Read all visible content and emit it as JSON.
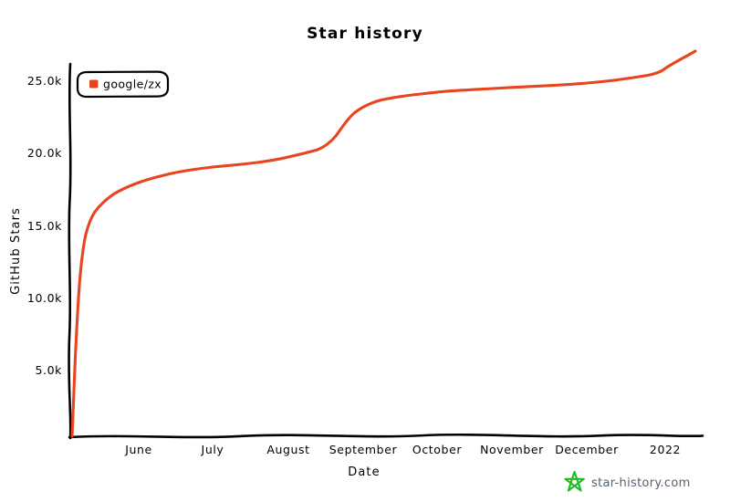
{
  "chart_data": {
    "type": "line",
    "title": "Star history",
    "xlabel": "Date",
    "ylabel": "GitHub Stars",
    "grid": false,
    "legend_position": "top-left",
    "x_tick_labels": [
      "June",
      "July",
      "August",
      "September",
      "October",
      "November",
      "December",
      "2022"
    ],
    "y_tick_labels": [
      "5.0k",
      "10.0k",
      "15.0k",
      "20.0k",
      "25.0k"
    ],
    "y_tick_values": [
      5000,
      10000,
      15000,
      20000,
      25000
    ],
    "ylim": [
      0,
      26500
    ],
    "xlim": [
      "2021-05-12",
      "2022-01-20"
    ],
    "series": [
      {
        "name": "google/zx",
        "color": "#E8441E",
        "x": [
          "2021-05-13",
          "2021-05-14",
          "2021-05-15",
          "2021-05-16",
          "2021-05-17",
          "2021-05-18",
          "2021-05-20",
          "2021-05-23",
          "2021-05-27",
          "2021-06-01",
          "2021-06-08",
          "2021-06-15",
          "2021-06-22",
          "2021-07-01",
          "2021-07-10",
          "2021-07-20",
          "2021-08-01",
          "2021-08-10",
          "2021-08-20",
          "2021-08-28",
          "2021-09-02",
          "2021-09-06",
          "2021-09-10",
          "2021-09-14",
          "2021-09-20",
          "2021-09-28",
          "2021-10-08",
          "2021-10-20",
          "2021-11-01",
          "2021-11-12",
          "2021-11-22",
          "2021-12-01",
          "2021-12-12",
          "2021-12-22",
          "2022-01-01",
          "2022-01-08",
          "2022-01-14"
        ],
        "y": [
          200,
          2600,
          5800,
          8600,
          10400,
          11600,
          12600,
          13100,
          13600,
          14600,
          15400,
          16000,
          16400,
          16800,
          17100,
          17400,
          17700,
          18000,
          18300,
          18700,
          19100,
          19800,
          20900,
          21700,
          22200,
          22500,
          22800,
          23000,
          23150,
          23300,
          23450,
          23500,
          23700,
          23900,
          24300,
          25100,
          26000
        ]
      }
    ],
    "annotations": {
      "watermark": "star-history.com",
      "watermark_icon": "star-icon",
      "watermark_icon_color": "#22BB22"
    }
  },
  "legend": {
    "items": [
      {
        "label": "google/zx",
        "marker": "square-marker",
        "color": "#E8441E"
      }
    ]
  }
}
